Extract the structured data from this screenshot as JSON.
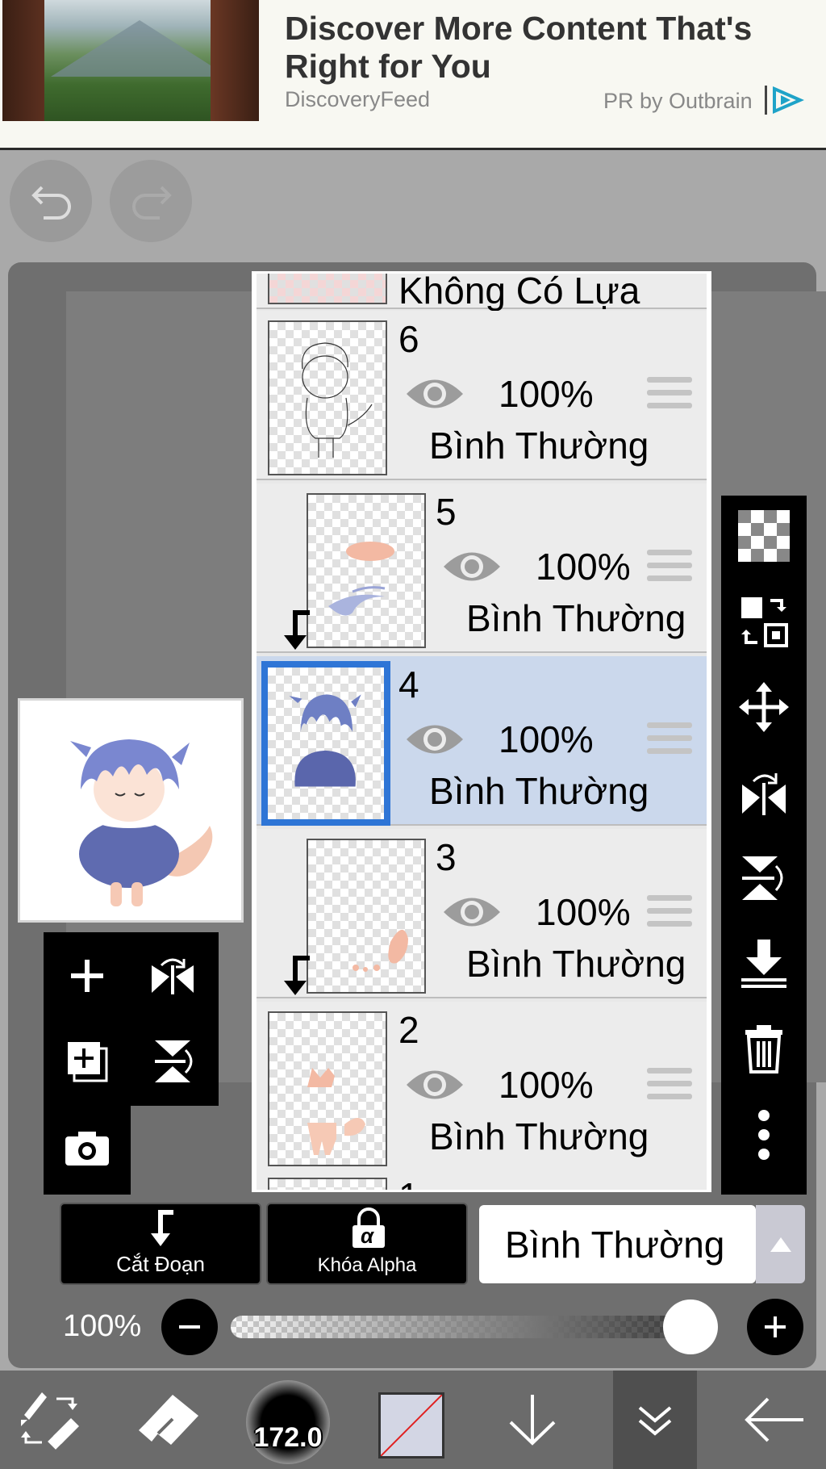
{
  "ad": {
    "title": "Discover More Content That's Right for You",
    "source": "DiscoveryFeed",
    "sponsor": "PR by Outbrain",
    "logo_icon": "outbrain-logo-icon"
  },
  "history": {
    "undo_icon": "undo-icon",
    "redo_icon": "redo-icon"
  },
  "layers": {
    "partial_top_label": "Không Có Lựa Chọn",
    "items": [
      {
        "number": "6",
        "opacity": "100%",
        "blend": "Bình Thường",
        "visible": true,
        "clipped": false,
        "selected": false
      },
      {
        "number": "5",
        "opacity": "100%",
        "blend": "Bình Thường",
        "visible": true,
        "clipped": true,
        "selected": false
      },
      {
        "number": "4",
        "opacity": "100%",
        "blend": "Bình Thường",
        "visible": true,
        "clipped": false,
        "selected": true
      },
      {
        "number": "3",
        "opacity": "100%",
        "blend": "Bình Thường",
        "visible": true,
        "clipped": true,
        "selected": false
      },
      {
        "number": "2",
        "opacity": "100%",
        "blend": "Bình Thường",
        "visible": true,
        "clipped": false,
        "selected": false
      }
    ],
    "partial_bottom_number": "1"
  },
  "right_toolbar": [
    "transparency-icon",
    "layer-transform-icon",
    "move-icon",
    "flip-horizontal-icon",
    "flip-vertical-icon",
    "merge-down-icon",
    "trash-icon",
    "more-icon"
  ],
  "left_tools": [
    "add-layer-icon",
    "flip-layer-horizontal-icon",
    "add-copy-layer-icon",
    "flip-layer-vertical-icon",
    "camera-icon"
  ],
  "bottom_controls": {
    "clipping_label": "Cắt Đoạn",
    "alpha_lock_label": "Khóa Alpha",
    "alpha_symbol": "α",
    "blend_mode": "Bình Thường"
  },
  "opacity": {
    "label": "100%",
    "value": 1.0
  },
  "bottom_bar": {
    "brush_size": "172.0",
    "active_color": "#d3d6e4",
    "items": [
      "tool-switch-icon",
      "eraser-icon",
      "brush-size",
      "color-swatch",
      "arrow-down-icon",
      "layers-collapse-icon",
      "back-arrow-icon"
    ]
  },
  "colors": {
    "selection_blue": "#2e75d6",
    "selected_row": "#cbd8ec",
    "hair_blue": "#6e7fc4"
  }
}
